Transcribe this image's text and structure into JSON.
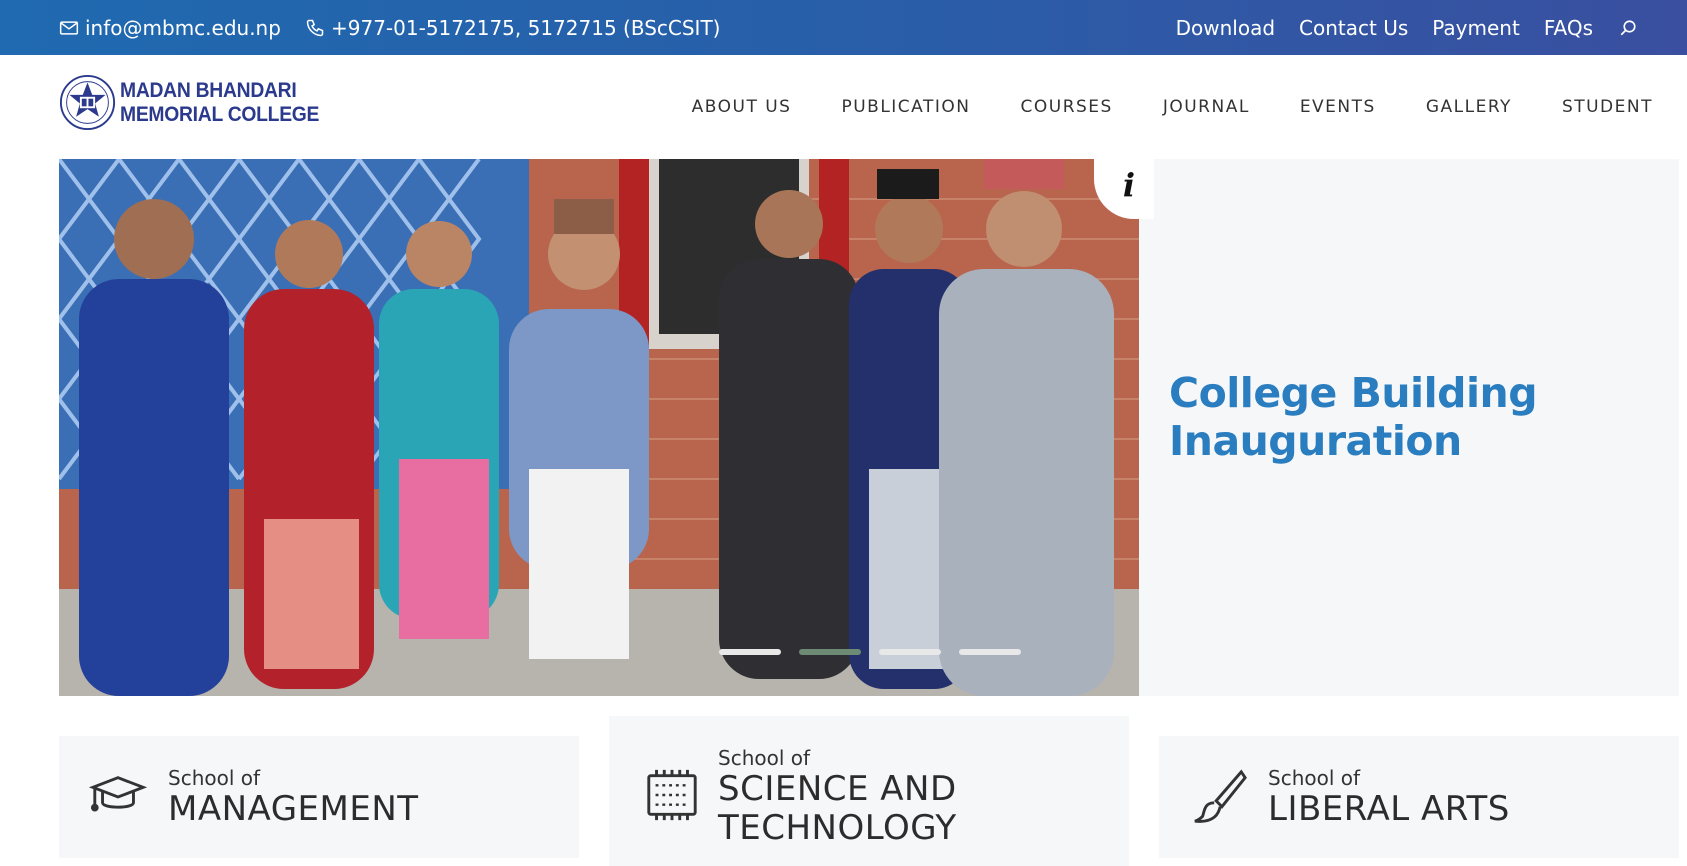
{
  "topbar": {
    "email": "info@mbmc.edu.np",
    "phone": "+977-01-5172175, 5172715 (BScCSIT)",
    "links": [
      "Download",
      "Contact Us",
      "Payment",
      "FAQs"
    ]
  },
  "logo": {
    "line1": "MADAN BHANDARI",
    "line2": "MEMORIAL COLLEGE"
  },
  "nav": [
    "ABOUT US",
    "PUBLICATION",
    "COURSES",
    "JOURNAL",
    "EVENTS",
    "GALLERY",
    "STUDENT"
  ],
  "slider": {
    "caption": "College Building Inauguration",
    "slides": 4,
    "active_slide": 2
  },
  "schools": [
    {
      "prefix": "School of",
      "name_line1": "MANAGEMENT",
      "name_line2": "",
      "icon": "graduation-cap-icon"
    },
    {
      "prefix": "School of",
      "name_line1": "SCIENCE AND",
      "name_line2": "TECHNOLOGY",
      "icon": "microchip-icon"
    },
    {
      "prefix": "School of",
      "name_line1": "LIBERAL ARTS",
      "name_line2": "",
      "icon": "paintbrush-icon"
    }
  ],
  "colors": {
    "topbar": "#1f6ab0",
    "logo_text": "#2b3a8c",
    "caption": "#2a7dbf",
    "active_dot": "#6d8a75",
    "card_bg": "#f5f7f9"
  }
}
